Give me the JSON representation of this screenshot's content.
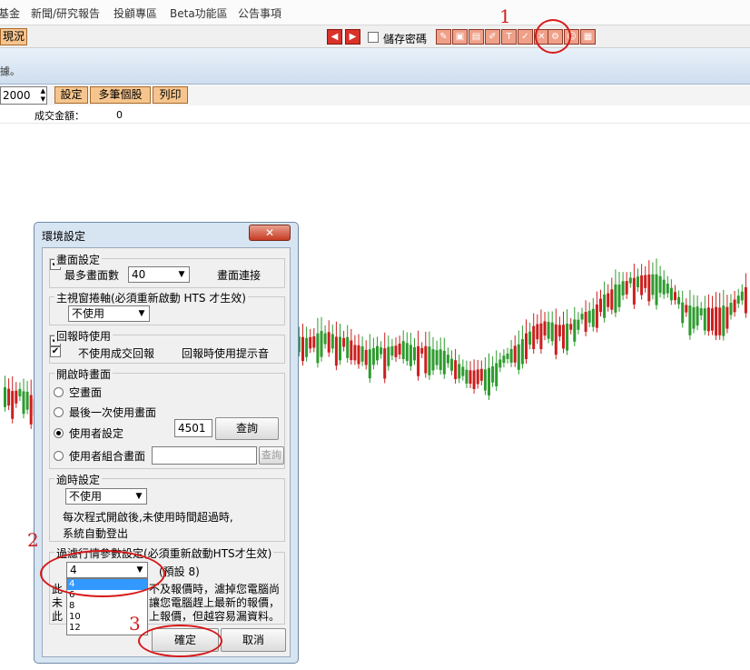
{
  "menu": [
    "基金",
    "新聞/研究報告",
    "投顧專區",
    "Beta功能區",
    "公告事項"
  ],
  "toolbar": {
    "left_button": "現況",
    "save_password_label": "儲存密碼",
    "icon_T": "T"
  },
  "status_text": "據。",
  "controls": {
    "count_value": "2000",
    "set_label": "設定",
    "multi_label": "多筆個股",
    "print_label": "列印"
  },
  "info": {
    "turnover_label": "成交金額：",
    "turnover_value": "0"
  },
  "dialog": {
    "title": "環境設定",
    "screen": {
      "title": "畫面設定",
      "max_label": "最多畫面數",
      "max_value": "40",
      "connect_label": "畫面連接"
    },
    "scroll": {
      "title": "主視窗捲軸(必須重新啟動 HTS 才生效)",
      "value": "不使用"
    },
    "report": {
      "title": "回報時使用",
      "no_deal_label": "不使用成交回報",
      "tip_label": "回報時使用提示音"
    },
    "startup": {
      "title": "開啟時畫面",
      "opt_empty": "空畫面",
      "opt_last": "最後一次使用畫面",
      "opt_user": "使用者設定",
      "user_value": "4501",
      "query_label": "查詢",
      "opt_combo": "使用者組合畫面",
      "query2_label": "查詢"
    },
    "timeout": {
      "title": "逾時設定",
      "value": "不使用",
      "desc1": "每次程式開啟後,未使用時間超過時,",
      "desc2": "系統自動登出"
    },
    "filter": {
      "title": "過濾行情參數設定(必須重新啟動HTS才生效)",
      "value": "4",
      "default_label": "(預設 8)",
      "options": [
        "4",
        "6",
        "8",
        "10",
        "12"
      ],
      "text1": "不及報價時，濾掉您電腦尚",
      "text2": "讓您電腦趕上最新的報價，",
      "text3": "上報價，但越容易漏資料。",
      "hidden1": "此",
      "hidden2": "未",
      "hidden3": "此"
    },
    "ok_label": "確定",
    "cancel_label": "取消"
  },
  "annotations": [
    "1",
    "2",
    "3"
  ],
  "colors": {
    "up": "#cc1f1f",
    "down": "#2e9b2e",
    "highlight": "#3399ff",
    "annotation": "#d81818"
  }
}
